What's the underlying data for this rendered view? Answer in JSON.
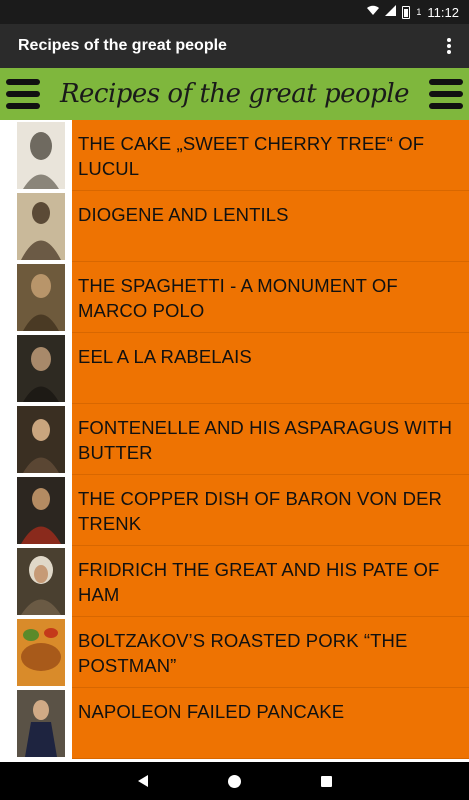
{
  "status_bar": {
    "time": "11:12",
    "battery_level": "1",
    "icons": [
      "wifi-icon",
      "signal-icon",
      "battery-icon"
    ]
  },
  "app_bar": {
    "title": "Recipes of the great people",
    "overflow_icon": "more-vert-icon"
  },
  "banner": {
    "title": "Recipes of the great people",
    "left_icon": "menu-icon",
    "right_icon": "menu-icon"
  },
  "recipes": [
    {
      "title": "THE CAKE „SWEET CHERRY TREE“ OF LUCUL"
    },
    {
      "title": "DIOGENE AND LENTILS"
    },
    {
      "title": "THE SPAGHETTI - A MONUMENT OF MARCO POLO"
    },
    {
      "title": "EEL A LA RABELAIS"
    },
    {
      "title": "FONTENELLE AND HIS ASPARAGUS WITH BUTTER"
    },
    {
      "title": "THE COPPER DISH OF BARON VON DER TRENK"
    },
    {
      "title": "FRIDRICH THE GREAT AND HIS PATE OF HAM"
    },
    {
      "title": "BOLTZAKOV’S ROASTED PORK “THE POSTMAN”"
    },
    {
      "title": "NAPOLEON FAILED PANCAKE"
    }
  ],
  "colors": {
    "row_background": "#ee7302",
    "banner_background": "#7fb73d",
    "app_bar_background": "#2b2b2b",
    "status_bar_background": "#1b1b1b"
  },
  "nav_bar": {
    "icons": [
      "back-icon",
      "home-icon",
      "recents-icon"
    ]
  }
}
